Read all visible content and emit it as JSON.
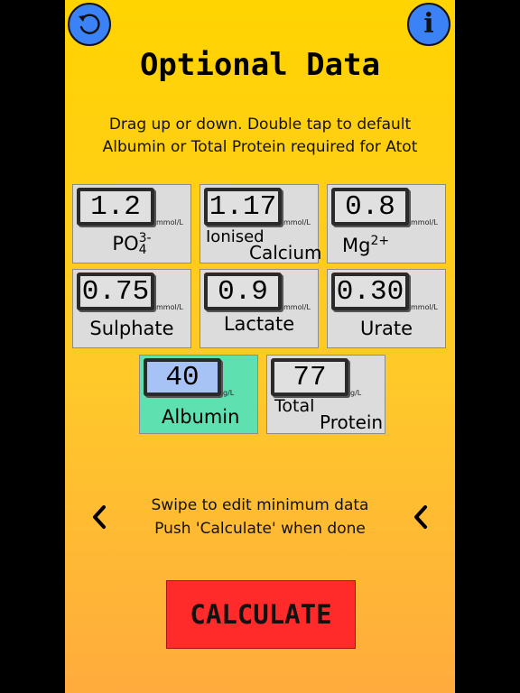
{
  "title": "Optional Data",
  "instructions": [
    "Drag up or down. Double tap to default",
    "Albumin or Total Protein required for Atot"
  ],
  "fields": {
    "phosphate": {
      "value": "1.2",
      "unit": "mmol/L",
      "label": "PO",
      "sup": "3-",
      "sub": "4"
    },
    "ionised_calcium": {
      "value": "1.17",
      "unit": "mmol/L",
      "label1": "Ionised",
      "label2": "Calcium"
    },
    "magnesium": {
      "value": "0.8",
      "unit": "mmol/L",
      "label": "Mg",
      "sup": "2+"
    },
    "sulphate": {
      "value": "0.75",
      "unit": "mmol/L",
      "label": "Sulphate"
    },
    "lactate": {
      "value": "0.9",
      "unit": "mmol/L",
      "label": "Lactate"
    },
    "urate": {
      "value": "0.30",
      "unit": "mmol/L",
      "label": "Urate"
    },
    "albumin": {
      "value": "40",
      "unit": "g/L",
      "label": "Albumin",
      "selected": true
    },
    "total_protein": {
      "value": "77",
      "unit": "g/L",
      "label1": "Total",
      "label2": "Protein"
    }
  },
  "swipe_hint": [
    "Swipe to edit minimum data",
    "Push 'Calculate' when done"
  ],
  "calculate_label": "CALCULATE",
  "info_label": "i",
  "icons": {
    "reset": "refresh-icon",
    "info": "info-icon",
    "nav": "chevron-left-icon"
  },
  "colors": {
    "background": "#ffd400",
    "selected_tile": "#5ee0b0",
    "tile": "#dcdcdc",
    "calculate": "#ff2a2a",
    "round_button": "#3b82f6"
  }
}
